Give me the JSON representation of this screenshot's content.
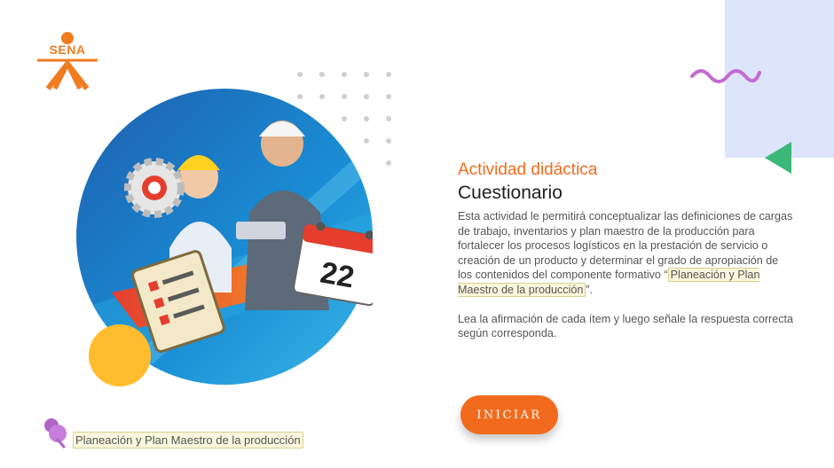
{
  "logo": {
    "text": "SENA"
  },
  "activity": {
    "kicker": "Actividad didáctica",
    "title": "Cuestionario",
    "paragraph1_before": "Esta actividad le permitirá conceptualizar  las definiciones de cargas de trabajo, inventarios y plan maestro de la producción para fortalecer los procesos logísticos en la prestación de servicio o creación de un producto y determinar el grado de apropiación de los contenidos del componente formativo “",
    "paragraph1_highlight": "Planeación y  Plan Maestro de la producción",
    "paragraph1_after": "”.",
    "paragraph2": "Lea la afirmación de cada ítem y luego señale la respuesta correcta según corresponda."
  },
  "start_button": {
    "label": "INICIAR"
  },
  "footer": {
    "label": "Planeación y  Plan  Maestro de la producción"
  },
  "illustration": {
    "calendar_day": "22"
  },
  "colors": {
    "accent": "#f26b1d",
    "yellow": "#ffbd2e",
    "green": "#3cb878",
    "lilac": "#dde5fb",
    "wave": "#c26ad1"
  }
}
